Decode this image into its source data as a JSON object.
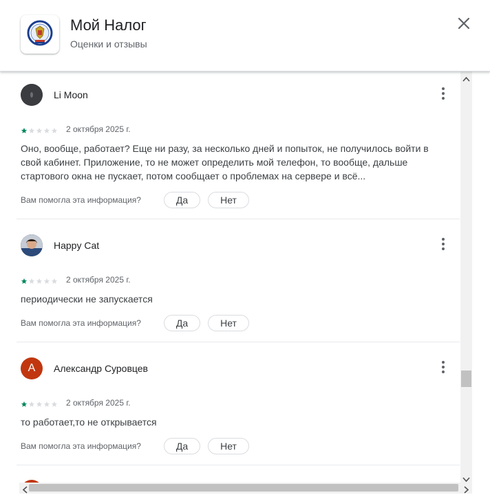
{
  "header": {
    "title": "Мой Налог",
    "subtitle": "Оценки и отзывы",
    "app_icon": "fns-emblem-icon",
    "close_icon": "close-icon"
  },
  "reviews": [
    {
      "author": "Li Moon",
      "avatar": "dark-photo-avatar",
      "rating": 1,
      "max_rating": 5,
      "date": "2 октября 2025 г.",
      "text_lines": [
        "Оно, вообще, работает? Еще ни разу, за несколько дней и попыток, не получилось войти в",
        "свой кабинет. Приложение, то не может определить мой телефон, то вообще, дальше",
        "стартового окна не пускает, потом сообщает о проблемах на сервере и всё..."
      ],
      "helpful_question": "Вам помогла эта информация?",
      "yes_label": "Да",
      "no_label": "Нет"
    },
    {
      "author": "Happy Cat",
      "avatar": "photo-avatar",
      "rating": 1,
      "max_rating": 5,
      "date": "2 октября 2025 г.",
      "text_lines": [
        "периодически не запускается"
      ],
      "helpful_question": "Вам помогла эта информация?",
      "yes_label": "Да",
      "no_label": "Нет"
    },
    {
      "author": "Александр Суровцев",
      "avatar_letter": "А",
      "rating": 1,
      "max_rating": 5,
      "date": "2 октября 2025 г.",
      "text_lines": [
        "то работает,то не открывается"
      ],
      "helpful_question": "Вам помогла эта информация?",
      "yes_label": "Да",
      "no_label": "Нет"
    }
  ],
  "colors": {
    "star_filled": "#01875f",
    "star_empty": "#dadce0",
    "avatar_letter_bg": "#c1360f",
    "text": "#3c4043",
    "muted": "#5f6368"
  }
}
